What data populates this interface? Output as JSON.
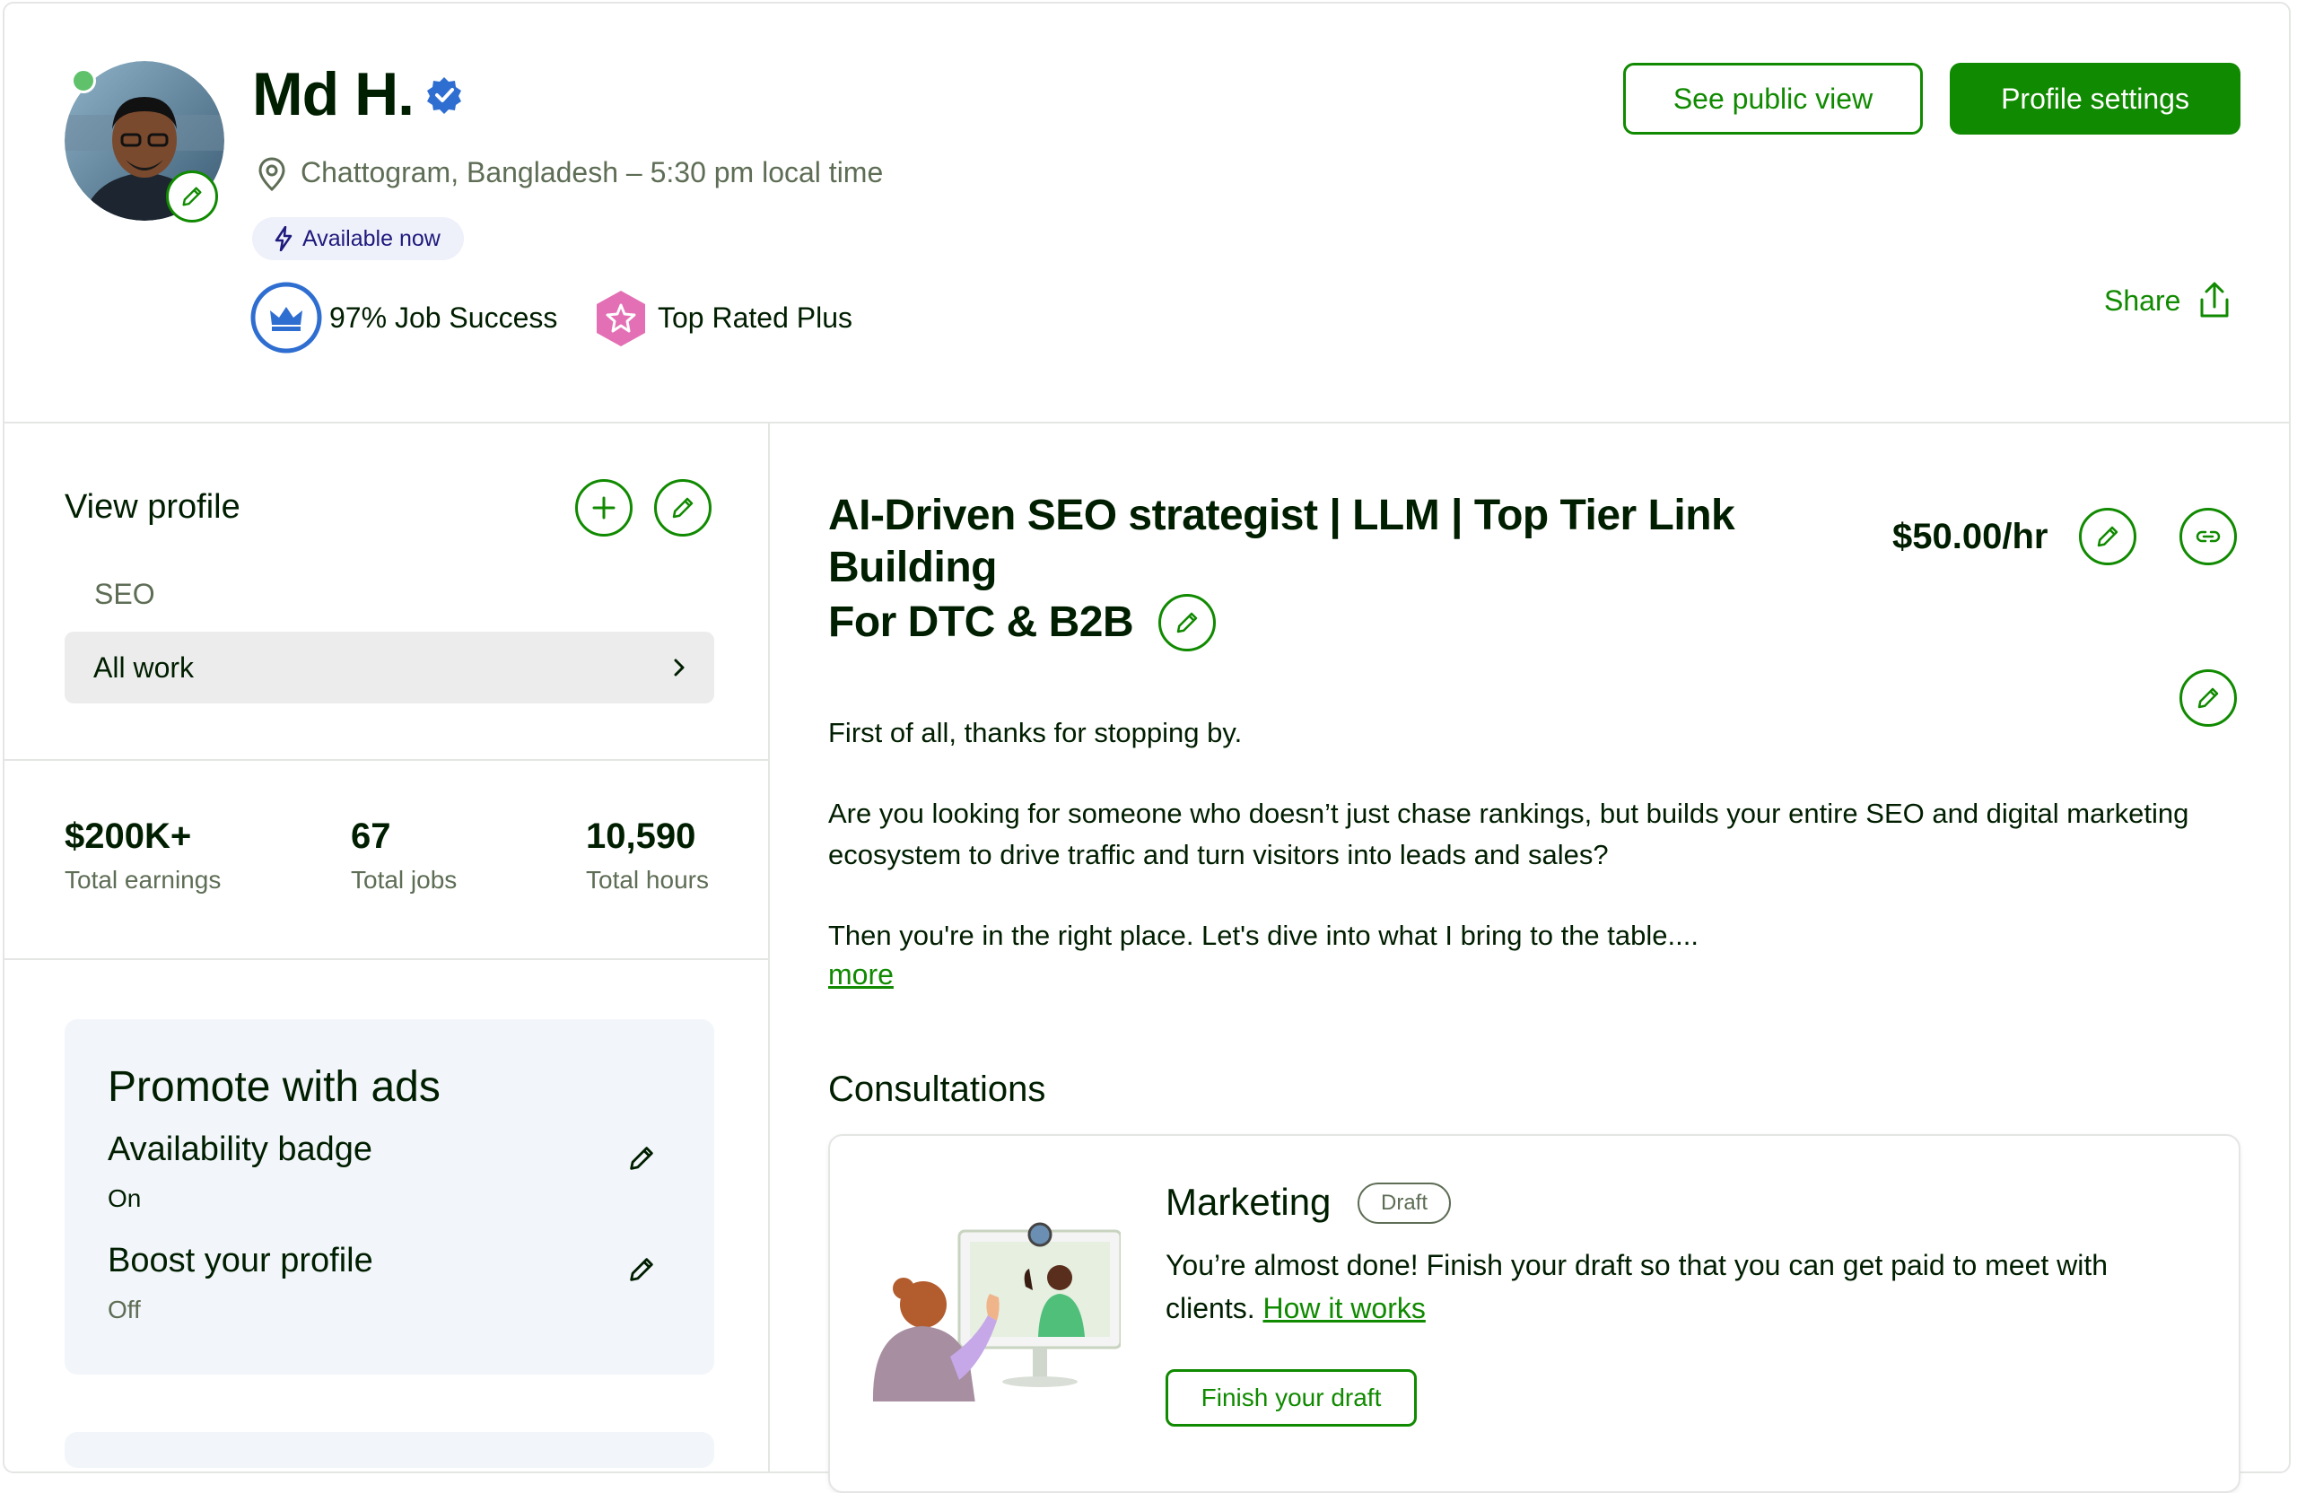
{
  "profile": {
    "name": "Md H.",
    "location": "Chattogram, Bangladesh – 5:30 pm local time",
    "availability": "Available now",
    "job_success": "97% Job Success",
    "badge": "Top Rated Plus"
  },
  "header": {
    "public_view_label": "See public view",
    "settings_label": "Profile settings",
    "share_label": "Share"
  },
  "sidebar": {
    "view_profile_title": "View profile",
    "specialization": "SEO",
    "all_work_label": "All work",
    "stats": [
      {
        "value": "$200K+",
        "label": "Total earnings"
      },
      {
        "value": "67",
        "label": "Total jobs"
      },
      {
        "value": "10,590",
        "label": "Total hours"
      }
    ],
    "promo": {
      "title": "Promote with ads",
      "availability_badge": {
        "label": "Availability badge",
        "value": "On"
      },
      "boost": {
        "label": "Boost your profile",
        "value": "Off"
      }
    }
  },
  "main": {
    "headline_line1": "AI-Driven SEO strategist | LLM | Top Tier Link Building",
    "headline_line2": "For DTC & B2B",
    "rate": "$50.00/hr",
    "bio": [
      "First of all, thanks for stopping by.",
      "Are you looking for someone who doesn’t just chase rankings, but builds your entire SEO and digital marketing ecosystem to drive traffic and turn visitors into leads and sales?",
      "Then you're in the right place. Let's dive into what I bring to the table...."
    ],
    "more_label": "more",
    "consultations": {
      "title": "Consultations",
      "card": {
        "title": "Marketing",
        "status": "Draft",
        "text": "You’re almost done! Finish your draft so that you can get paid to meet with clients.",
        "link": "How it works",
        "button": "Finish your draft"
      }
    }
  },
  "colors": {
    "brand_green": "#108a00",
    "online_green": "#5fc16a",
    "verified_blue": "#2f6ed1",
    "top_rated_pink": "#e36fb4"
  },
  "icons": [
    "edit-icon",
    "verified-icon",
    "location-icon",
    "lightning-icon",
    "crown-icon",
    "star-badge-icon",
    "share-icon",
    "plus-icon",
    "chevron-right-icon",
    "link-icon"
  ]
}
